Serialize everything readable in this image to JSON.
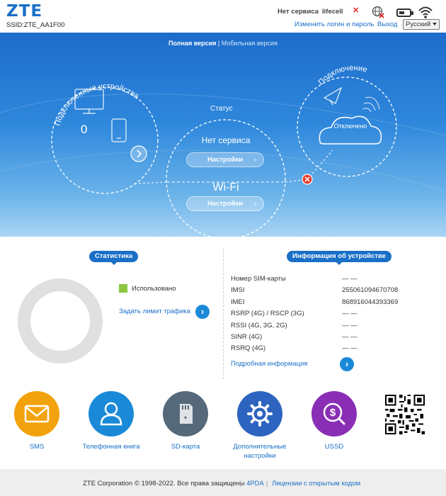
{
  "header": {
    "logo": "ZTE",
    "ssid": "SSID:ZTE_AA1F00",
    "network_status": "Нет сервиса",
    "operator": "lifecell",
    "change_login_link": "Изменить логин и пароль",
    "logout_link": "Выход",
    "language_selected": "Русский",
    "icons": [
      "sim-missing-icon",
      "globe-disconnected-icon",
      "battery-icon",
      "wifi-signal-icon"
    ]
  },
  "version_switch": {
    "full": "Полная версия",
    "separator": "|",
    "mobile": "Мобильная версия"
  },
  "hero": {
    "connected_devices_title": "Подключенные устройства",
    "connected_count": "0",
    "status_title": "Статус",
    "network_service": "Нет сервиса",
    "settings_label_1": "Настройки",
    "wifi_label": "Wi-Fi",
    "settings_label_2": "Настройки",
    "connection_title": "Подключение",
    "connection_state": "Отключено"
  },
  "statistics": {
    "badge": "Статистика",
    "legend_used": "Использовано",
    "set_limit_link": "Задать лимит трафика",
    "used_fraction": 0
  },
  "device_info": {
    "badge": "Информация об устройстве",
    "rows": [
      {
        "label": "Номер SIM-карты",
        "value": "— —"
      },
      {
        "label": "IMSI",
        "value": "255061094670708"
      },
      {
        "label": "IMEI",
        "value": "868916044393369"
      },
      {
        "label": "RSRP (4G) / RSCP (3G)",
        "value": "— —"
      },
      {
        "label": "RSSI (4G, 3G, 2G)",
        "value": "— —"
      },
      {
        "label": "SINR (4G)",
        "value": "— —"
      },
      {
        "label": "RSRQ (4G)",
        "value": "— —"
      }
    ],
    "more_link": "Подробная информация"
  },
  "apps": [
    {
      "label": "SMS",
      "color": "#f2a20c",
      "icon": "envelope-icon"
    },
    {
      "label": "Телефонная книга",
      "color": "#1a8ad8",
      "icon": "person-icon"
    },
    {
      "label": "SD-карта",
      "color": "#56697a",
      "icon": "sd-card-icon"
    },
    {
      "label": "Дополнительные настройки",
      "color": "#2d64c0",
      "icon": "gear-icon"
    },
    {
      "label": "USSD",
      "color": "#8a2fb5",
      "icon": "dollar-icon"
    }
  ],
  "footer": {
    "copyright": "ZTE Corporation © 1998-2022. Все права защищены",
    "sep1": "|",
    "link_4pda": "4PDA",
    "sep2": "|",
    "licenses_link": "Лицензии с открытым кодом"
  },
  "colors": {
    "accent": "#1a6fc7",
    "legend_used": "#8cc63f",
    "error": "#d9261c"
  }
}
